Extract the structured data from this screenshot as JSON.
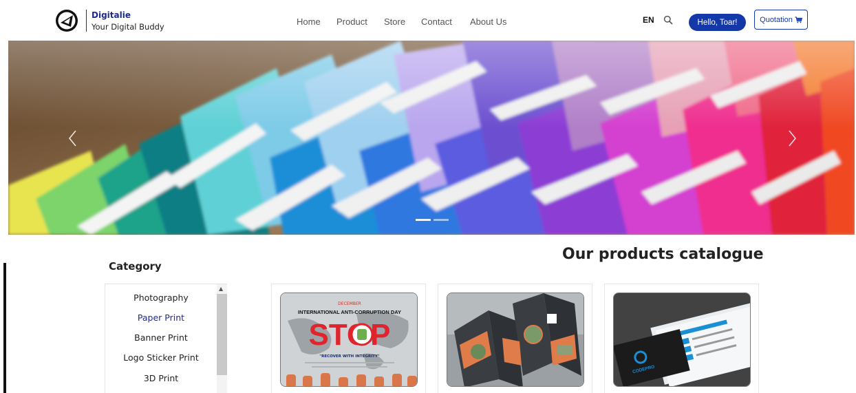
{
  "header": {
    "brand_name": "Digitalie",
    "brand_tagline": "Your Digital Buddy",
    "nav": [
      "Home",
      "Product",
      "Store",
      "Contact",
      "About Us"
    ],
    "language": "EN",
    "hello_label": "Hello, Toar!",
    "quotation_label": "Quotation",
    "accent_color": "#1538a8"
  },
  "hero": {
    "slide_count": 2,
    "active_slide": 1,
    "icons": [
      "chevron-left-icon",
      "chevron-right-icon"
    ]
  },
  "category": {
    "title": "Category",
    "items": [
      "Photography",
      "Paper Print",
      "Banner Print",
      "Logo Sticker Print",
      "3D Print"
    ],
    "active_item": "Paper Print"
  },
  "catalogue": {
    "title": "Our products catalogue",
    "products": [
      {
        "image_text_month": "DECEMBER",
        "image_text_heading": "INTERNATIONAL ANTI-CORRUPTION DAY",
        "image_text_main": "STOP",
        "image_text_quote": "\"RECOVER WITH INTEGRITY\""
      },
      {
        "image_subject": "tri-fold brochure"
      },
      {
        "image_subject": "business cards",
        "image_text_brand": "CODEPRO"
      }
    ]
  }
}
